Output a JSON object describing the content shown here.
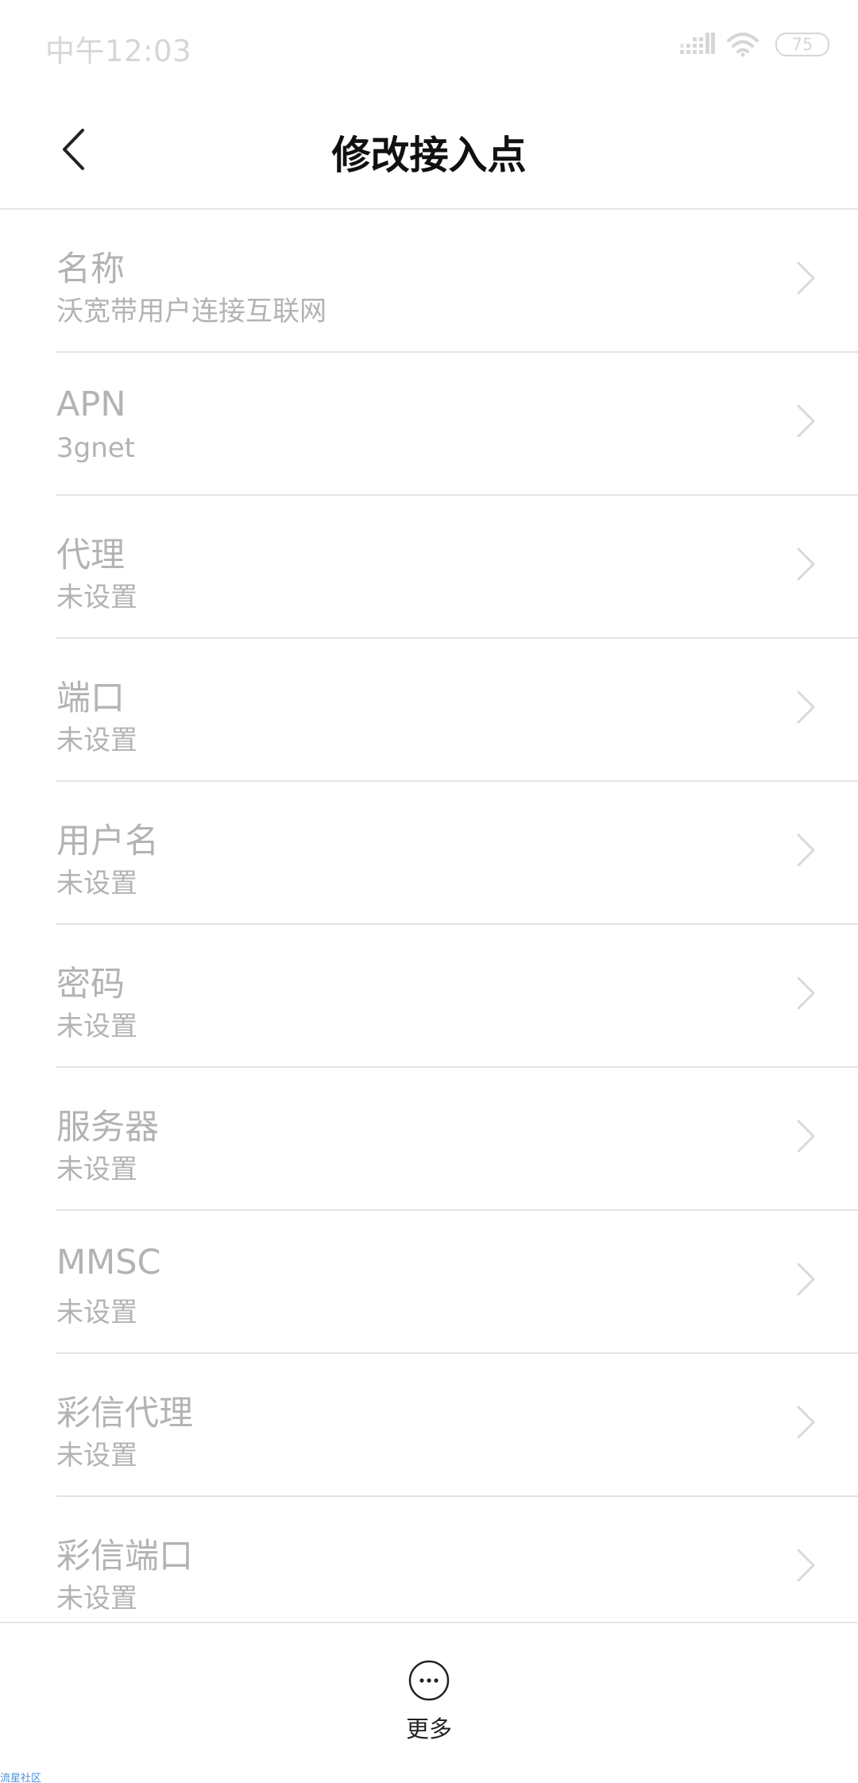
{
  "status_bar": {
    "time": "中午12:03",
    "battery": "75"
  },
  "header": {
    "title": "修改接入点"
  },
  "items": [
    {
      "label": "名称",
      "value": "沃宽带用户连接互联网"
    },
    {
      "label": "APN",
      "value": "3gnet"
    },
    {
      "label": "代理",
      "value": "未设置"
    },
    {
      "label": "端口",
      "value": "未设置"
    },
    {
      "label": "用户名",
      "value": "未设置"
    },
    {
      "label": "密码",
      "value": "未设置"
    },
    {
      "label": "服务器",
      "value": "未设置"
    },
    {
      "label": "MMSC",
      "value": "未设置"
    },
    {
      "label": "彩信代理",
      "value": "未设置"
    },
    {
      "label": "彩信端口",
      "value": "未设置"
    }
  ],
  "bottom_bar": {
    "more_label": "更多"
  },
  "watermark": "流星社区",
  "colors": {
    "title": "#111111",
    "item_text": "#b3b3b3",
    "divider": "#e3e3e3",
    "status": "#d6d6d6"
  }
}
